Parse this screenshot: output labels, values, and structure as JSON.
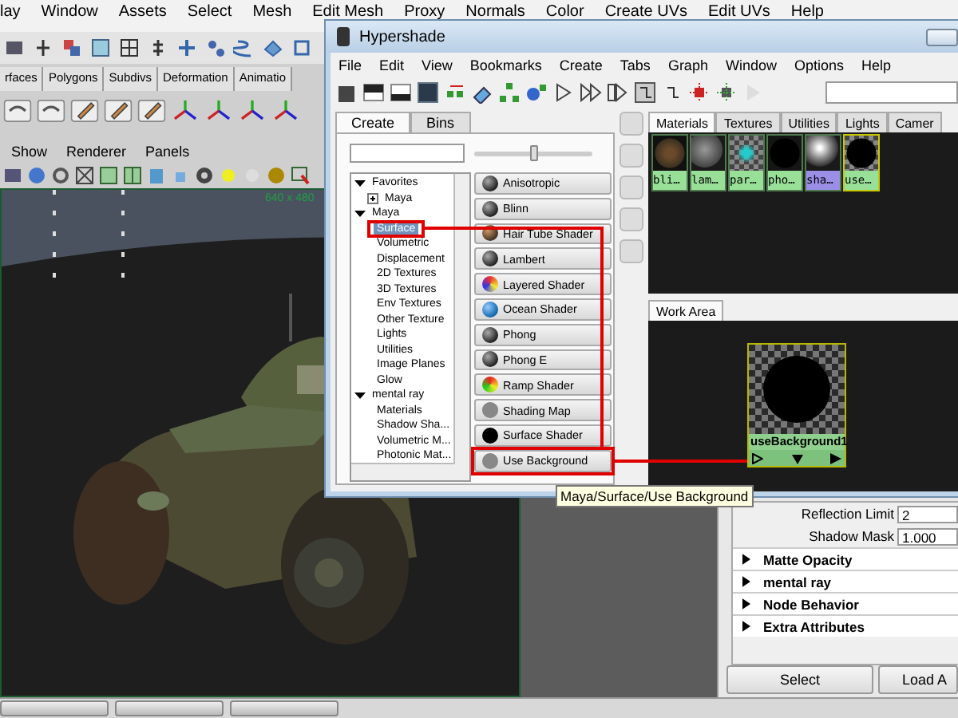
{
  "main_window": {
    "menu": [
      "lay",
      "Window",
      "Assets",
      "Select",
      "Mesh",
      "Edit Mesh",
      "Proxy",
      "Normals",
      "Color",
      "Create UVs",
      "Edit UVs",
      "Help"
    ],
    "shelf_tabs": [
      {
        "label": "rfaces",
        "selected": false
      },
      {
        "label": "Polygons",
        "selected": false
      },
      {
        "label": "Subdivs",
        "selected": false
      },
      {
        "label": "Deformation",
        "selected": false
      },
      {
        "label": "Animatio",
        "selected": false
      }
    ],
    "panel_menu": [
      "Show",
      "Renderer",
      "Panels"
    ],
    "viewport": {
      "resolution": "640 x 480"
    },
    "attribute_editor": {
      "fields": [
        {
          "label": "Reflection Limit",
          "value": "2"
        },
        {
          "label": "Shadow Mask",
          "value": "1.000"
        }
      ],
      "sections": [
        {
          "label": "Matte Opacity",
          "expanded": false
        },
        {
          "label": "mental ray",
          "expanded": false
        },
        {
          "label": "Node Behavior",
          "expanded": false
        },
        {
          "label": "Extra Attributes",
          "expanded": false
        }
      ],
      "buttons": [
        "Select",
        "Load A"
      ]
    }
  },
  "hypershade": {
    "title": "Hypershade",
    "menu": [
      "File",
      "Edit",
      "View",
      "Bookmarks",
      "Create",
      "Tabs",
      "Graph",
      "Window",
      "Options",
      "Help"
    ],
    "create_tabs": [
      {
        "label": "Create",
        "selected": true
      },
      {
        "label": "Bins",
        "selected": false
      }
    ],
    "slider": {
      "level": 0.5
    },
    "tree": [
      {
        "label": "Favorites",
        "selected": false,
        "expanded": true,
        "children": [
          {
            "label": "Maya",
            "selected": false,
            "expanded": false
          }
        ]
      },
      {
        "label": "Maya",
        "selected": false,
        "expanded": true,
        "children": [
          {
            "label": "Surface",
            "selected": true
          },
          {
            "label": "Volumetric",
            "selected": false
          },
          {
            "label": "Displacement",
            "selected": false
          },
          {
            "label": "2D Textures",
            "selected": false
          },
          {
            "label": "3D Textures",
            "selected": false
          },
          {
            "label": "Env Textures",
            "selected": false
          },
          {
            "label": "Other Texture",
            "selected": false
          },
          {
            "label": "Lights",
            "selected": false
          },
          {
            "label": "Utilities",
            "selected": false
          },
          {
            "label": "Image Planes",
            "selected": false
          },
          {
            "label": "Glow",
            "selected": false
          }
        ]
      },
      {
        "label": "mental ray",
        "selected": false,
        "expanded": true,
        "children": [
          {
            "label": "Materials",
            "selected": false
          },
          {
            "label": "Shadow Sha...",
            "selected": false
          },
          {
            "label": "Volumetric M...",
            "selected": false
          },
          {
            "label": "Photonic Mat...",
            "selected": false
          }
        ]
      }
    ],
    "shader_buttons": [
      {
        "label": "Anisotropic",
        "kind": "sphere"
      },
      {
        "label": "Blinn",
        "kind": "sphere"
      },
      {
        "label": "Hair Tube Shader",
        "kind": "hair"
      },
      {
        "label": "Lambert",
        "kind": "sphere"
      },
      {
        "label": "Layered Shader",
        "kind": "layered"
      },
      {
        "label": "Ocean Shader",
        "kind": "ocean"
      },
      {
        "label": "Phong",
        "kind": "sphere"
      },
      {
        "label": "Phong E",
        "kind": "sphere"
      },
      {
        "label": "Ramp Shader",
        "kind": "ramp"
      },
      {
        "label": "Shading Map",
        "kind": "flat"
      },
      {
        "label": "Surface Shader",
        "kind": "black"
      },
      {
        "label": "Use Background",
        "kind": "flat"
      }
    ],
    "tabs": [
      {
        "label": "Materials",
        "selected": true
      },
      {
        "label": "Textures",
        "selected": false
      },
      {
        "label": "Utilities",
        "selected": false
      },
      {
        "label": "Lights",
        "selected": false
      },
      {
        "label": "Camer",
        "selected": false
      }
    ],
    "swatches": [
      {
        "label": "bli…",
        "kind": "textured",
        "color": "#98e098",
        "selected": false
      },
      {
        "label": "lam…",
        "kind": "grey",
        "color": "#98e098",
        "selected": false
      },
      {
        "label": "par…",
        "kind": "checker-cyan",
        "color": "#98e098",
        "selected": false
      },
      {
        "label": "pho…",
        "kind": "black",
        "color": "#98e098",
        "selected": false
      },
      {
        "label": "sha…",
        "kind": "shiny",
        "color": "#9a8ee6",
        "selected": false
      },
      {
        "label": "use…",
        "kind": "checker-black",
        "color": "#98e098",
        "selected": true
      }
    ],
    "work_area": {
      "tab": "Work Area",
      "node": {
        "label": "useBackground1"
      }
    }
  },
  "tooltip": "Maya/Surface/Use Background"
}
